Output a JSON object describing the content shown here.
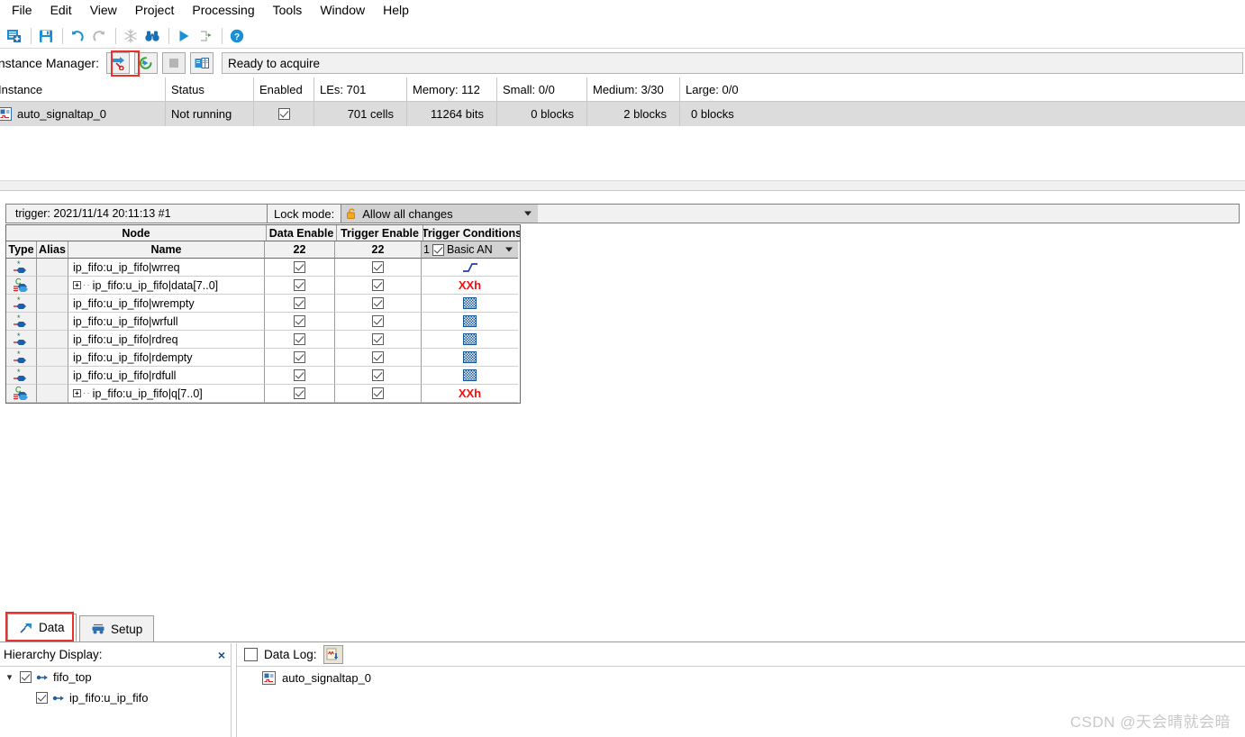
{
  "menu": {
    "items": [
      {
        "label": "File"
      },
      {
        "label": "Edit"
      },
      {
        "label": "View"
      },
      {
        "label": "Project"
      },
      {
        "label": "Processing"
      },
      {
        "label": "Tools"
      },
      {
        "label": "Window"
      },
      {
        "label": "Help"
      }
    ]
  },
  "toolbar": {
    "icons": [
      {
        "name": "new-signaltap-file-icon"
      },
      {
        "name": "save-icon"
      },
      {
        "name": "undo-icon"
      },
      {
        "name": "redo-icon"
      },
      {
        "name": "snowflake-icon"
      },
      {
        "name": "find-icon"
      },
      {
        "name": "run-analysis-icon"
      },
      {
        "name": "recompile-icon"
      },
      {
        "name": "help-icon"
      }
    ]
  },
  "instance_manager": {
    "title": "Instance Manager:",
    "buttons": [
      {
        "name": "run-analysis-button",
        "label": "Run Analysis"
      },
      {
        "name": "autorun-analysis-button",
        "label": "Autorun Analysis"
      },
      {
        "name": "stop-analysis-button",
        "label": "Stop Analysis"
      },
      {
        "name": "read-data-button",
        "label": "Read Data"
      }
    ],
    "status": "Ready to acquire",
    "columns": [
      "Instance",
      "Status",
      "Enabled",
      "LEs: 701",
      "Memory: 112",
      "Small: 0/0",
      "Medium: 3/30",
      "Large: 0/0"
    ],
    "rows": [
      {
        "instance": "auto_signaltap_0",
        "status": "Not running",
        "enabled": true,
        "les": "701 cells",
        "memory": "11264 bits",
        "small": "0 blocks",
        "medium": "2 blocks",
        "large": "0 blocks"
      }
    ]
  },
  "trigger_panel": {
    "trigger_label": "trigger: 2021/11/14 20:11:13  #1",
    "lock_mode_label": "Lock mode:",
    "lock_mode_value": "Allow all changes",
    "grid": {
      "group_headers": [
        "Node",
        "Data Enable",
        "Trigger Enable",
        "Trigger Conditions"
      ],
      "sub_headers": [
        "Type",
        "Alias",
        "Name"
      ],
      "data_enable_count": "22",
      "trigger_enable_count": "22",
      "condition_index": "1",
      "condition_type": "Basic AN",
      "rows": [
        {
          "type": "bit",
          "alias": "",
          "name": "ip_fifo:u_ip_fifo|wrreq",
          "expandable": false,
          "data_enable": true,
          "trigger_enable": true,
          "condition": "rising-edge"
        },
        {
          "type": "bus",
          "alias": "",
          "name": "ip_fifo:u_ip_fifo|data[7..0]",
          "expandable": true,
          "data_enable": true,
          "trigger_enable": true,
          "condition": "XXh"
        },
        {
          "type": "bit",
          "alias": "",
          "name": "ip_fifo:u_ip_fifo|wrempty",
          "expandable": false,
          "data_enable": true,
          "trigger_enable": true,
          "condition": "dont-care"
        },
        {
          "type": "bit",
          "alias": "",
          "name": "ip_fifo:u_ip_fifo|wrfull",
          "expandable": false,
          "data_enable": true,
          "trigger_enable": true,
          "condition": "dont-care"
        },
        {
          "type": "bit",
          "alias": "",
          "name": "ip_fifo:u_ip_fifo|rdreq",
          "expandable": false,
          "data_enable": true,
          "trigger_enable": true,
          "condition": "dont-care"
        },
        {
          "type": "bit",
          "alias": "",
          "name": "ip_fifo:u_ip_fifo|rdempty",
          "expandable": false,
          "data_enable": true,
          "trigger_enable": true,
          "condition": "dont-care"
        },
        {
          "type": "bit",
          "alias": "",
          "name": "ip_fifo:u_ip_fifo|rdfull",
          "expandable": false,
          "data_enable": true,
          "trigger_enable": true,
          "condition": "dont-care"
        },
        {
          "type": "bus",
          "alias": "",
          "name": "ip_fifo:u_ip_fifo|q[7..0]",
          "expandable": true,
          "data_enable": true,
          "trigger_enable": true,
          "condition": "XXh"
        }
      ]
    }
  },
  "tabs": [
    {
      "label": "Data",
      "selected": true,
      "icon": "data-tab-icon"
    },
    {
      "label": "Setup",
      "selected": false,
      "icon": "setup-tab-icon"
    }
  ],
  "hierarchy": {
    "title": "Hierarchy Display:",
    "close": "×",
    "items": [
      {
        "label": "fifo_top",
        "checked": true,
        "depth": 0,
        "expanded": true
      },
      {
        "label": "ip_fifo:u_ip_fifo",
        "checked": true,
        "depth": 1,
        "expanded": null
      }
    ]
  },
  "data_log": {
    "title": "Data Log:",
    "checked": false,
    "items": [
      {
        "label": "auto_signaltap_0"
      }
    ]
  },
  "watermark": "CSDN @天会晴就会暗",
  "colors": {
    "accent_blue": "#1a8fd6",
    "highlight_red": "#e8332a",
    "bus_red": "#ee1111",
    "node_blue": "#15559a"
  }
}
